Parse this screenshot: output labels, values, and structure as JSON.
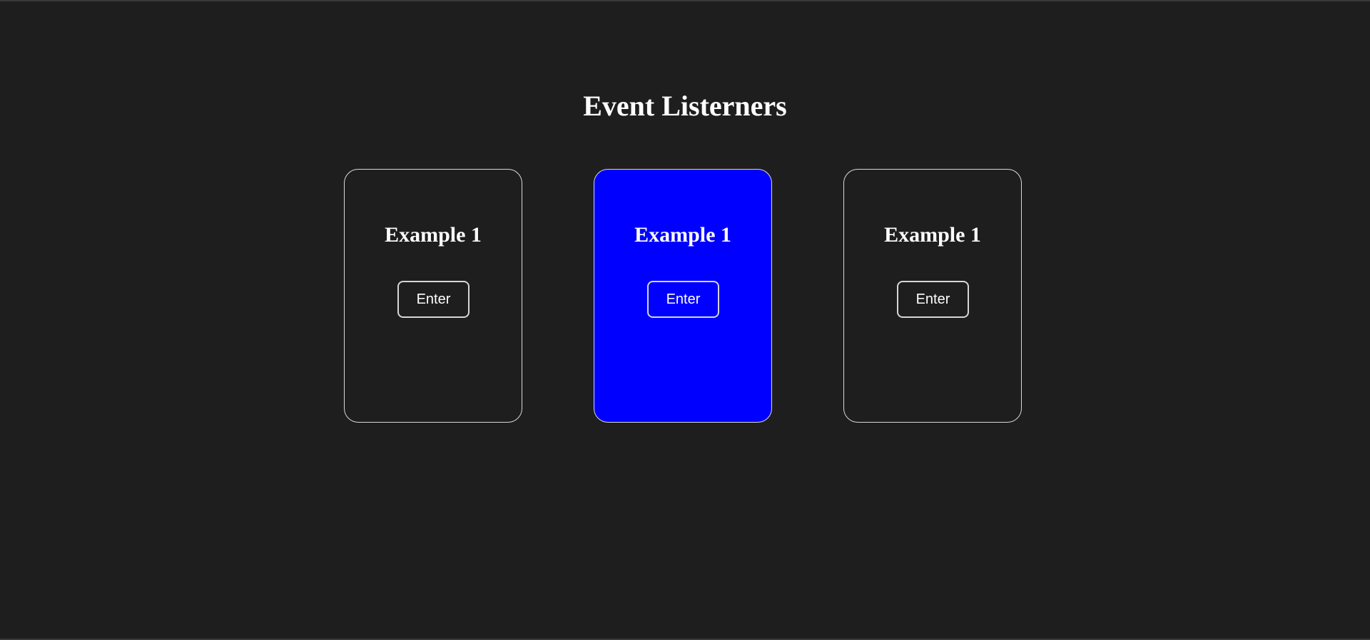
{
  "page": {
    "title": "Event Listerners"
  },
  "cards": [
    {
      "title": "Example 1",
      "button_label": "Enter",
      "active": false
    },
    {
      "title": "Example 1",
      "button_label": "Enter",
      "active": true
    },
    {
      "title": "Example 1",
      "button_label": "Enter",
      "active": false
    }
  ],
  "colors": {
    "background": "#1f1e1f",
    "active_card": "#0000ff",
    "border": "#d9d9d9",
    "text": "#ffffff"
  }
}
